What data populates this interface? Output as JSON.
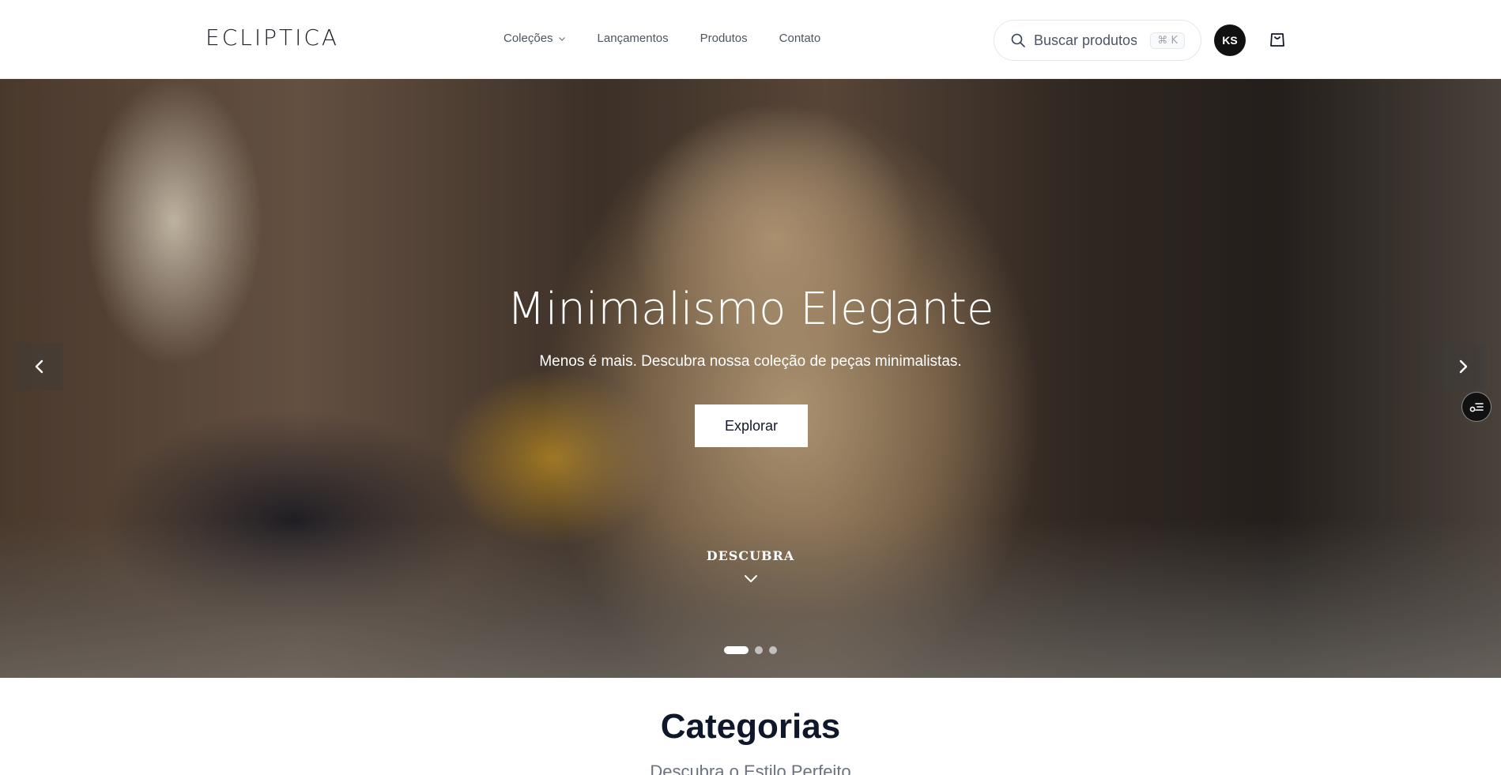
{
  "header": {
    "logo": "ECLIPTICA",
    "nav": [
      {
        "label": "Coleções",
        "has_dropdown": true
      },
      {
        "label": "Lançamentos"
      },
      {
        "label": "Produtos"
      },
      {
        "label": "Contato"
      }
    ],
    "search": {
      "placeholder": "Buscar produtos",
      "shortcut": "⌘ K"
    },
    "avatar_initials": "KS",
    "cart_icon": "shopping-bag-icon"
  },
  "hero": {
    "title": "Minimalismo Elegante",
    "subtitle": "Menos é mais. Descubra nossa coleção de peças minimalistas.",
    "cta_label": "Explorar",
    "discover_label": "DESCUBRA",
    "slides_total": 3,
    "active_slide": 1,
    "prev_icon": "chevron-left-icon",
    "next_icon": "chevron-right-icon",
    "float_icon": "preferences-icon"
  },
  "categories": {
    "title": "Categorias",
    "subtitle": "Descubra o Estilo Perfeito"
  },
  "colors": {
    "accent_dark": "#111111",
    "hero_text": "#ffffff"
  }
}
